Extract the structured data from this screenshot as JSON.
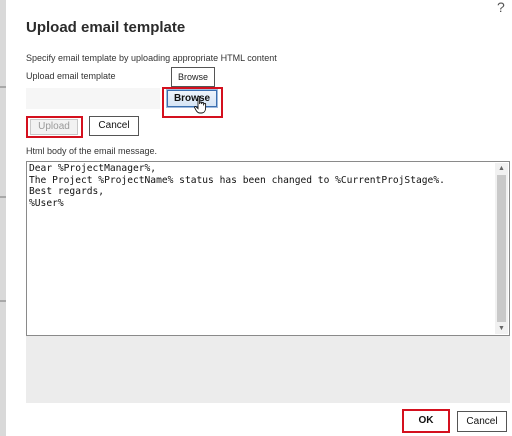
{
  "dialog": {
    "title": "Upload email template",
    "help_icon": "?",
    "description": "Specify email template by uploading appropriate HTML content"
  },
  "upload": {
    "label": "Upload email template",
    "file_value": "",
    "tooltip": "Browse",
    "browse_label": "Browse",
    "upload_label": "Upload",
    "cancel_label": "Cancel"
  },
  "editor": {
    "label": "Html body of the email message.",
    "content": "Dear %ProjectManager%,\nThe Project %ProjectName% status has been changed to %CurrentProjStage%.\nBest regards,\n%User%",
    "scroll_up_icon": "chevron-up-icon",
    "scroll_down_icon": "chevron-down-icon"
  },
  "footer": {
    "ok_label": "OK",
    "cancel_label": "Cancel"
  },
  "colors": {
    "highlight": "#d4101e",
    "browse_border": "#3a6fb0"
  }
}
